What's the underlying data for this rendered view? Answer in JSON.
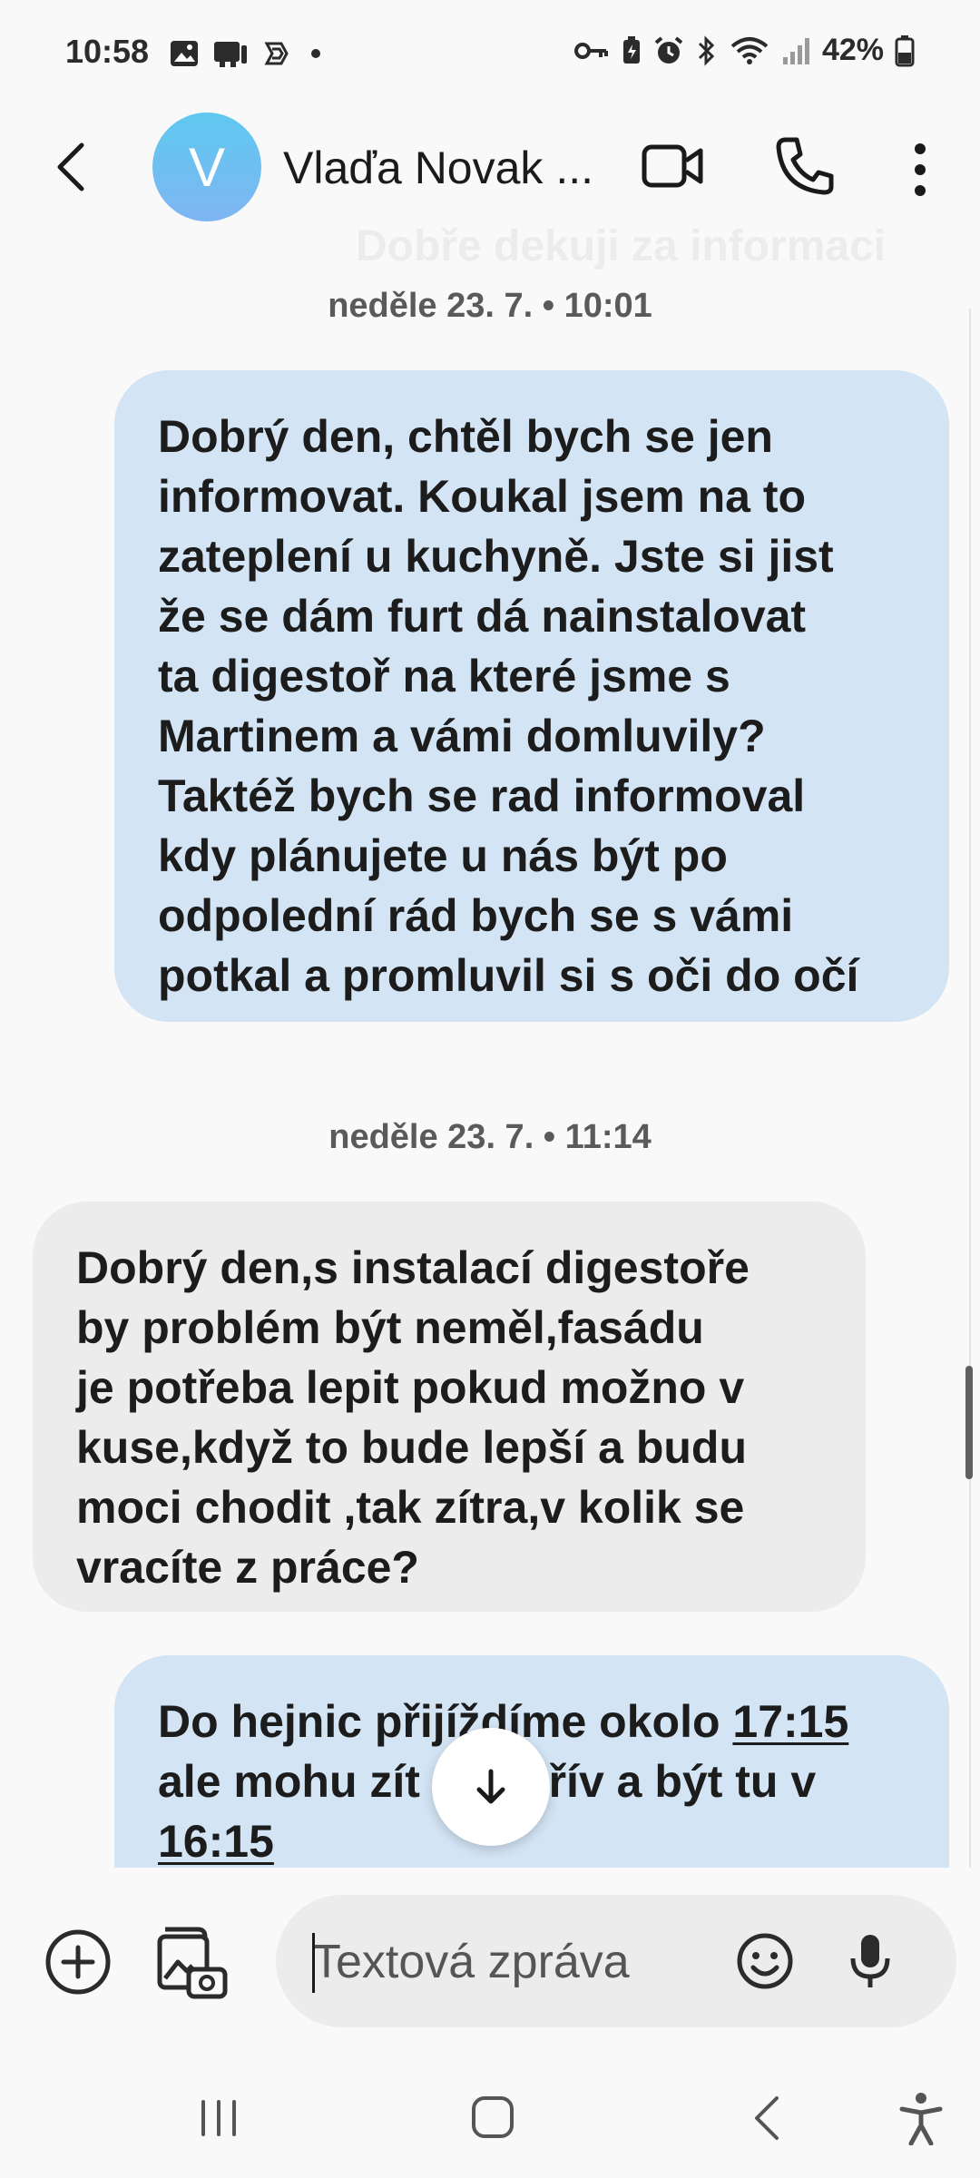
{
  "status_bar": {
    "time": "10:58",
    "battery_pct": "42%",
    "left_icons": [
      "gallery-icon",
      "sim-icon",
      "app-icon",
      "dot-icon"
    ],
    "right_icons": [
      "key-icon",
      "battery-saver-icon",
      "alarm-icon",
      "bluetooth-icon",
      "wifi-icon",
      "signal-icon",
      "battery-icon"
    ]
  },
  "header": {
    "avatar_letter": "V",
    "contact_name": "Vlaďa Novak ...",
    "ghost_text": "Dobře dekuji za informaci"
  },
  "messages": [
    {
      "type": "date",
      "text": "neděle 23. 7. • 10:01"
    },
    {
      "type": "outgoing",
      "lines": [
        "Dobrý den,  chtěl bych se jen",
        "informovat. Koukal jsem na to",
        "zateplení u kuchyně.  Jste si jist",
        "že se dám furt dá nainstalovat",
        "ta digestoř na které jsme s",
        "Martinem a vámi domluvily?",
        "Taktéž bych se rad informoval",
        "kdy plánujete u nás být po",
        "odpolední rád bych se s vámi",
        "potkal a promluvil si s oči do očí"
      ]
    },
    {
      "type": "date",
      "text": "neděle 23. 7. • 11:14"
    },
    {
      "type": "incoming",
      "lines": [
        "Dobrý den,s instalací digestoře",
        "by problém být neměl,fasádu",
        "je potřeba lepit pokud možno v",
        "kuse,když to bude lepší a budu",
        "moci chodit ,tak zítra,v kolik se",
        "vracíte z práce?"
      ]
    },
    {
      "type": "outgoing",
      "line1_pre": "Do hejnic přijíždíme okolo ",
      "line1_link": "17:15",
      "line2": "ale mohu zít        dřív a být tu v",
      "line3_link": "16:15"
    }
  ],
  "composer": {
    "placeholder": "Textová zpráva"
  },
  "colors": {
    "outgoing_bubble": "#d3e4f4",
    "incoming_bubble": "#ececec",
    "avatar": "#6cc0f0",
    "background": "#f9f9f9"
  }
}
